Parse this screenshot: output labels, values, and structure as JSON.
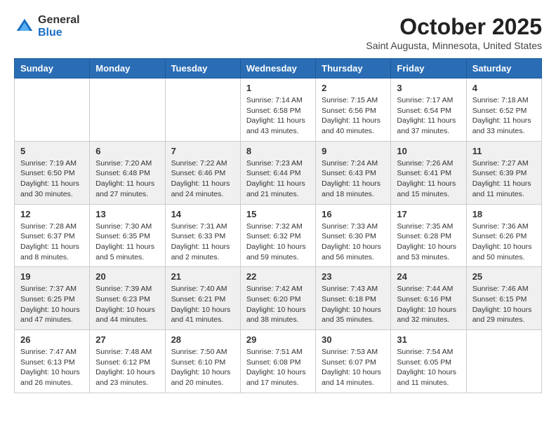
{
  "header": {
    "logo_general": "General",
    "logo_blue": "Blue",
    "month": "October 2025",
    "location": "Saint Augusta, Minnesota, United States"
  },
  "days_of_week": [
    "Sunday",
    "Monday",
    "Tuesday",
    "Wednesday",
    "Thursday",
    "Friday",
    "Saturday"
  ],
  "weeks": [
    [
      {
        "day": "",
        "info": ""
      },
      {
        "day": "",
        "info": ""
      },
      {
        "day": "",
        "info": ""
      },
      {
        "day": "1",
        "info": "Sunrise: 7:14 AM\nSunset: 6:58 PM\nDaylight: 11 hours and 43 minutes."
      },
      {
        "day": "2",
        "info": "Sunrise: 7:15 AM\nSunset: 6:56 PM\nDaylight: 11 hours and 40 minutes."
      },
      {
        "day": "3",
        "info": "Sunrise: 7:17 AM\nSunset: 6:54 PM\nDaylight: 11 hours and 37 minutes."
      },
      {
        "day": "4",
        "info": "Sunrise: 7:18 AM\nSunset: 6:52 PM\nDaylight: 11 hours and 33 minutes."
      }
    ],
    [
      {
        "day": "5",
        "info": "Sunrise: 7:19 AM\nSunset: 6:50 PM\nDaylight: 11 hours and 30 minutes."
      },
      {
        "day": "6",
        "info": "Sunrise: 7:20 AM\nSunset: 6:48 PM\nDaylight: 11 hours and 27 minutes."
      },
      {
        "day": "7",
        "info": "Sunrise: 7:22 AM\nSunset: 6:46 PM\nDaylight: 11 hours and 24 minutes."
      },
      {
        "day": "8",
        "info": "Sunrise: 7:23 AM\nSunset: 6:44 PM\nDaylight: 11 hours and 21 minutes."
      },
      {
        "day": "9",
        "info": "Sunrise: 7:24 AM\nSunset: 6:43 PM\nDaylight: 11 hours and 18 minutes."
      },
      {
        "day": "10",
        "info": "Sunrise: 7:26 AM\nSunset: 6:41 PM\nDaylight: 11 hours and 15 minutes."
      },
      {
        "day": "11",
        "info": "Sunrise: 7:27 AM\nSunset: 6:39 PM\nDaylight: 11 hours and 11 minutes."
      }
    ],
    [
      {
        "day": "12",
        "info": "Sunrise: 7:28 AM\nSunset: 6:37 PM\nDaylight: 11 hours and 8 minutes."
      },
      {
        "day": "13",
        "info": "Sunrise: 7:30 AM\nSunset: 6:35 PM\nDaylight: 11 hours and 5 minutes."
      },
      {
        "day": "14",
        "info": "Sunrise: 7:31 AM\nSunset: 6:33 PM\nDaylight: 11 hours and 2 minutes."
      },
      {
        "day": "15",
        "info": "Sunrise: 7:32 AM\nSunset: 6:32 PM\nDaylight: 10 hours and 59 minutes."
      },
      {
        "day": "16",
        "info": "Sunrise: 7:33 AM\nSunset: 6:30 PM\nDaylight: 10 hours and 56 minutes."
      },
      {
        "day": "17",
        "info": "Sunrise: 7:35 AM\nSunset: 6:28 PM\nDaylight: 10 hours and 53 minutes."
      },
      {
        "day": "18",
        "info": "Sunrise: 7:36 AM\nSunset: 6:26 PM\nDaylight: 10 hours and 50 minutes."
      }
    ],
    [
      {
        "day": "19",
        "info": "Sunrise: 7:37 AM\nSunset: 6:25 PM\nDaylight: 10 hours and 47 minutes."
      },
      {
        "day": "20",
        "info": "Sunrise: 7:39 AM\nSunset: 6:23 PM\nDaylight: 10 hours and 44 minutes."
      },
      {
        "day": "21",
        "info": "Sunrise: 7:40 AM\nSunset: 6:21 PM\nDaylight: 10 hours and 41 minutes."
      },
      {
        "day": "22",
        "info": "Sunrise: 7:42 AM\nSunset: 6:20 PM\nDaylight: 10 hours and 38 minutes."
      },
      {
        "day": "23",
        "info": "Sunrise: 7:43 AM\nSunset: 6:18 PM\nDaylight: 10 hours and 35 minutes."
      },
      {
        "day": "24",
        "info": "Sunrise: 7:44 AM\nSunset: 6:16 PM\nDaylight: 10 hours and 32 minutes."
      },
      {
        "day": "25",
        "info": "Sunrise: 7:46 AM\nSunset: 6:15 PM\nDaylight: 10 hours and 29 minutes."
      }
    ],
    [
      {
        "day": "26",
        "info": "Sunrise: 7:47 AM\nSunset: 6:13 PM\nDaylight: 10 hours and 26 minutes."
      },
      {
        "day": "27",
        "info": "Sunrise: 7:48 AM\nSunset: 6:12 PM\nDaylight: 10 hours and 23 minutes."
      },
      {
        "day": "28",
        "info": "Sunrise: 7:50 AM\nSunset: 6:10 PM\nDaylight: 10 hours and 20 minutes."
      },
      {
        "day": "29",
        "info": "Sunrise: 7:51 AM\nSunset: 6:08 PM\nDaylight: 10 hours and 17 minutes."
      },
      {
        "day": "30",
        "info": "Sunrise: 7:53 AM\nSunset: 6:07 PM\nDaylight: 10 hours and 14 minutes."
      },
      {
        "day": "31",
        "info": "Sunrise: 7:54 AM\nSunset: 6:05 PM\nDaylight: 10 hours and 11 minutes."
      },
      {
        "day": "",
        "info": ""
      }
    ]
  ]
}
